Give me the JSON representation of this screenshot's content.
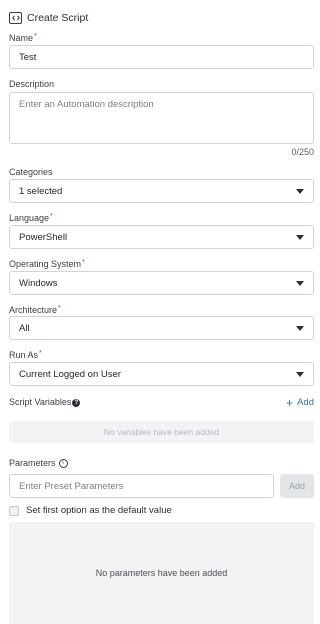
{
  "header": {
    "title": "Create Script",
    "icon": "code-icon"
  },
  "name": {
    "label": "Name",
    "required_mark": "*",
    "value": "Test"
  },
  "description": {
    "label": "Description",
    "placeholder": "Enter an Automation description",
    "counter": "0/250"
  },
  "categories": {
    "label": "Categories",
    "value": "1 selected"
  },
  "language": {
    "label": "Language",
    "required_mark": "*",
    "value": "PowerShell"
  },
  "operating_system": {
    "label": "Operating System",
    "required_mark": "*",
    "value": "Windows"
  },
  "architecture": {
    "label": "Architecture",
    "required_mark": "*",
    "value": "All"
  },
  "run_as": {
    "label": "Run As",
    "required_mark": "*",
    "value": "Current Logged on User"
  },
  "script_variables": {
    "label": "Script Variables",
    "add_label": "Add",
    "empty_text": "No variables have been added"
  },
  "parameters": {
    "label": "Parameters",
    "placeholder": "Enter Preset Parameters",
    "add_label": "Add",
    "checkbox_label": "Set first option as the default value",
    "empty_text": "No parameters have been added"
  },
  "colors": {
    "link": "#2f6fb3",
    "required": "#c0392b",
    "border": "#cfd4da",
    "empty_bg": "#f2f3f5"
  }
}
